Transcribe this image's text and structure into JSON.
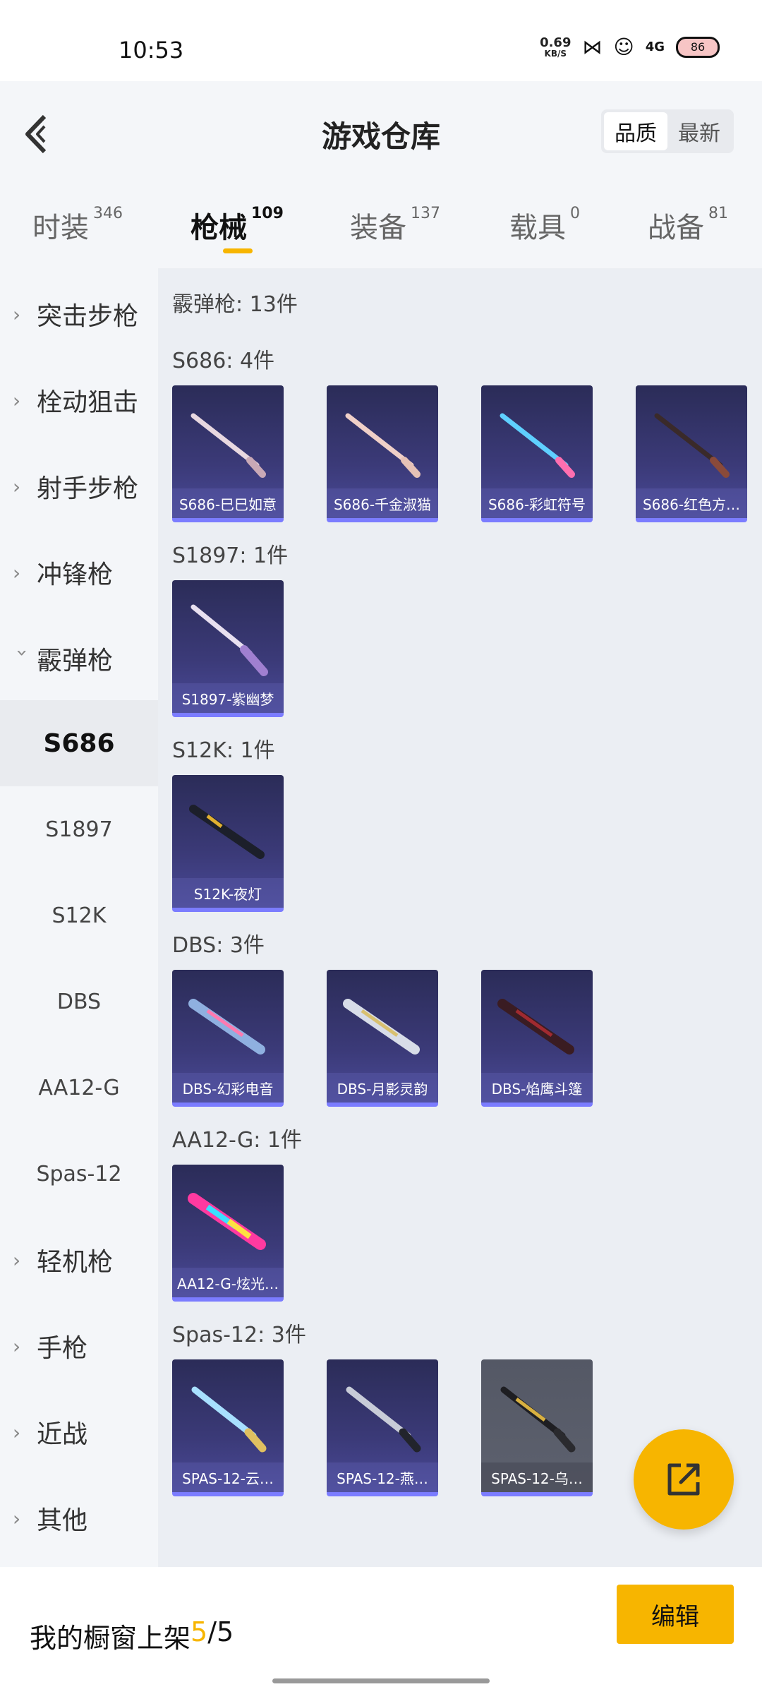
{
  "status": {
    "time": "10:53",
    "net_speed": "0.69",
    "net_unit": "KB/S",
    "signal_label": "4G",
    "battery": "86"
  },
  "header": {
    "title": "游戏仓库",
    "sort": [
      "品质",
      "最新"
    ]
  },
  "tabs": [
    {
      "name": "时装",
      "count": "346"
    },
    {
      "name": "枪械",
      "count": "109"
    },
    {
      "name": "装备",
      "count": "137"
    },
    {
      "name": "载具",
      "count": "0"
    },
    {
      "name": "战备",
      "count": "81"
    }
  ],
  "sidebar": {
    "categories": [
      "突击步枪",
      "栓动狙击",
      "射手步枪",
      "冲锋枪",
      "霰弹枪",
      "轻机枪",
      "手枪",
      "近战",
      "其他"
    ],
    "sub": [
      "S686",
      "S1897",
      "S12K",
      "DBS",
      "AA12-G",
      "Spas-12"
    ]
  },
  "content": {
    "section_title": "霰弹枪: 13件",
    "groups": [
      {
        "title": "S686: 4件",
        "items": [
          "S686-巳巳如意",
          "S686-千金淑猫",
          "S686-彩虹符号",
          "S686-红色方…"
        ]
      },
      {
        "title": "S1897: 1件",
        "items": [
          "S1897-紫幽梦"
        ]
      },
      {
        "title": "S12K: 1件",
        "items": [
          "S12K-夜灯"
        ]
      },
      {
        "title": "DBS: 3件",
        "items": [
          "DBS-幻彩电音",
          "DBS-月影灵韵",
          "DBS-焰鹰斗篷"
        ]
      },
      {
        "title": "AA12-G: 1件",
        "items": [
          "AA12-G-炫光…"
        ]
      },
      {
        "title": "Spas-12: 3件",
        "items": [
          "SPAS-12-云…",
          "SPAS-12-燕…",
          "SPAS-12-乌…"
        ]
      }
    ]
  },
  "bottom": {
    "showcase_prefix": "我的橱窗上架 ",
    "showcase_count": "5",
    "showcase_total": "/5",
    "edit_label": "编辑"
  },
  "colors": {
    "accent": "#f7b500",
    "card_bg": "#3b3a78",
    "card_border": "#7b7cff"
  }
}
